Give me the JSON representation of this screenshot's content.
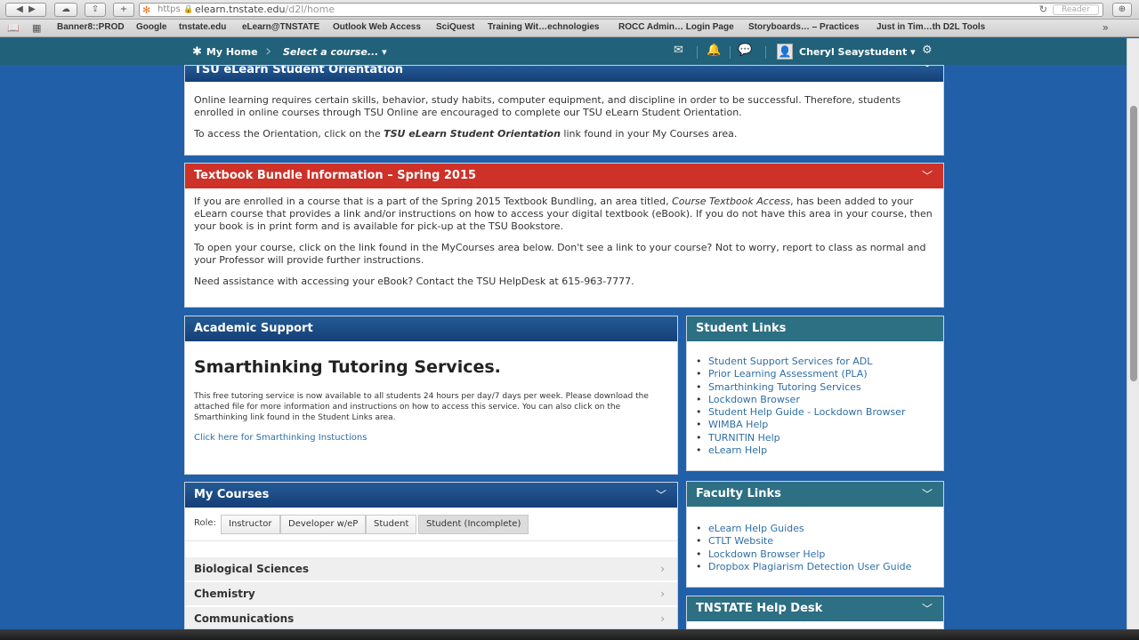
{
  "browser": {
    "https_label": "https",
    "url_host": "elearn.tnstate.edu",
    "url_path": "/d2l/home",
    "reader_label": "Reader"
  },
  "bookmarks": [
    "Banner8::PROD",
    "Google",
    "tnstate.edu",
    "eLearn@TNSTATE",
    "Outlook Web Access",
    "SciQuest",
    "Training Wit…echnologies",
    "ROCC Admin… Login Page",
    "Storyboards… – Practices",
    "Just in Tim…th D2L Tools"
  ],
  "nav": {
    "home_label": "My Home",
    "course_select": "Select a course... ▾",
    "user_name": "Cheryl Seaystudent ▾"
  },
  "orientation": {
    "title": "TSU eLearn Student Orientation",
    "para1": "Online learning requires certain skills, behavior, study habits, computer equipment, and discipline in order to be successful. Therefore, students enrolled in online courses through TSU Online are encouraged to complete our TSU eLearn Student Orientation.",
    "para2_pre": "To access the Orientation, click on the ",
    "para2_bold": "TSU eLearn Student Orientation",
    "para2_post": " link found in your My Courses area."
  },
  "textbook": {
    "title": "Textbook Bundle Information – Spring 2015",
    "para1_pre": "If you are enrolled in a course that is a part of the Spring 2015 Textbook Bundling, an area titled, ",
    "para1_it": "Course Textbook Access",
    "para1_post": ", has been added to your eLearn course that provides a link and/or instructions on how to access your digital textbook (eBook).  If you do not have this area in your course, then your book is in print form and is available for pick-up at the TSU Bookstore.",
    "para2": "To open your course, click on the link found in the MyCourses area below. Don't see a link to your course? Not to worry, report to class as normal and your Professor will provide further instructions.",
    "para3": "Need assistance with accessing your eBook? Contact the TSU HelpDesk at 615-963-7777."
  },
  "academic": {
    "title": "Academic Support",
    "heading": "Smarthinking Tutoring Services.",
    "text": "This free tutoring service is now available to all students 24 hours per day/7 days per week.  Please download the attached file for more information and instructions on how to access this service. You can also click on the Smarthinking link found in the Student Links area.",
    "link": "Click here for Smarthinking Instuctions"
  },
  "student_links": {
    "title": "Student Links",
    "items": [
      "Student Support Services for ADL",
      "Prior Learning Assessment (PLA)",
      "Smarthinking Tutoring Services",
      "Lockdown Browser",
      "Student Help Guide - Lockdown Browser",
      "WIMBA Help",
      "TURNITIN Help",
      "eLearn Help"
    ]
  },
  "faculty_links": {
    "title": "Faculty Links",
    "items": [
      "eLearn Help Guides",
      "CTLT Website",
      "Lockdown Browser Help",
      "Dropbox Plagiarism Detection User Guide"
    ]
  },
  "helpdesk": {
    "title": "TNSTATE Help Desk"
  },
  "my_courses": {
    "title": "My Courses",
    "role_label": "Role:",
    "roles": [
      "Instructor",
      "Developer w/eP",
      "Student",
      "Student (Incomplete)"
    ],
    "courses": [
      "Biological Sciences",
      "Chemistry",
      "Communications"
    ]
  },
  "colors": {
    "page_background": "#2160a8",
    "nav_bar": "#21617a",
    "header_blue": "#1e4f8a",
    "header_red": "#cd3128",
    "header_teal": "#2d6f83",
    "link": "#2e6ea4"
  }
}
